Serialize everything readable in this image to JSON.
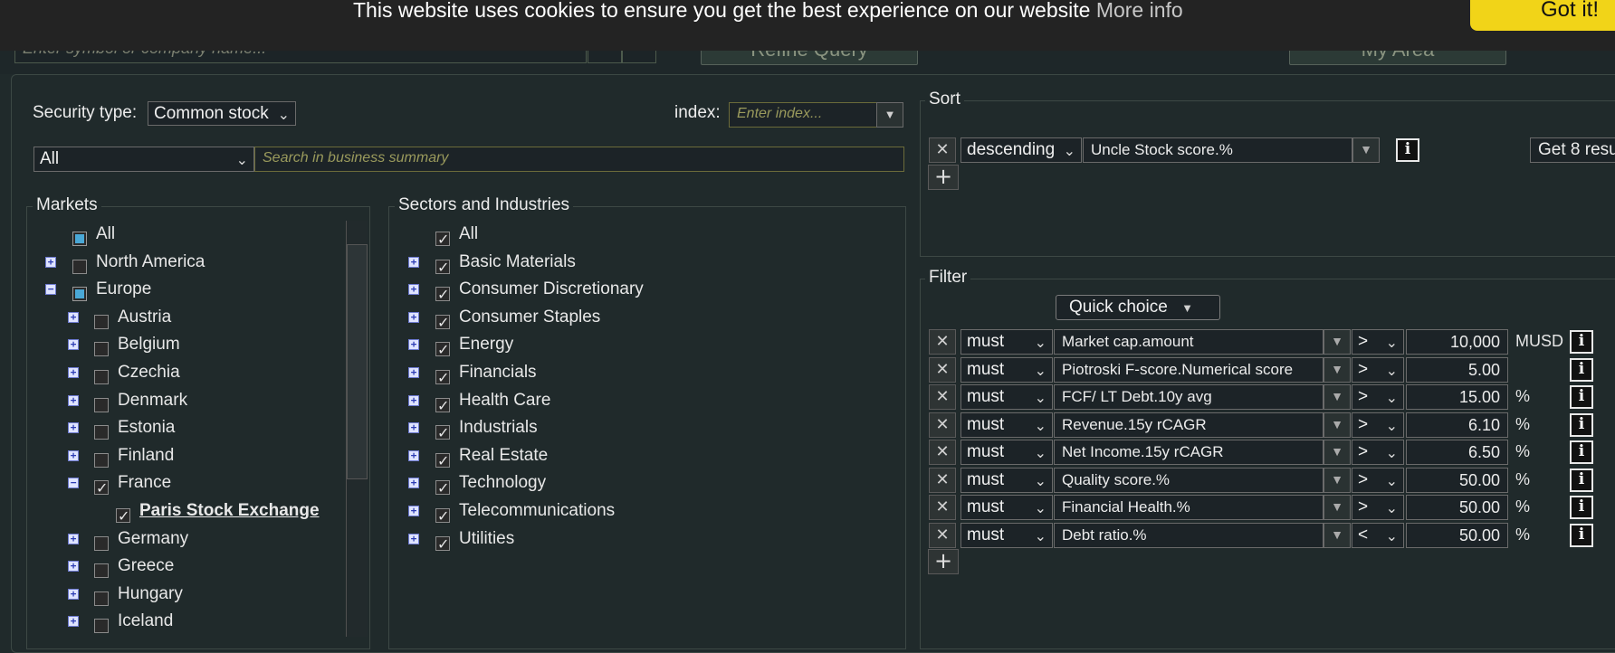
{
  "top": {
    "search_placeholder": "Enter symbol or company name...",
    "refine_label": "Refine Query",
    "myarea_label": "My Area"
  },
  "cookie": {
    "message": "This website uses cookies to ensure you get the best experience on our website",
    "more_info": "More info",
    "got_it": "Got it!"
  },
  "security": {
    "label": "Security type:",
    "value": "Common stock",
    "index_label": "index:",
    "index_placeholder": "Enter index...",
    "scope_value": "All",
    "business_placeholder": "Search in business summary"
  },
  "markets": {
    "title": "Markets",
    "items": [
      {
        "label": "All",
        "state": "partial",
        "expander": "",
        "level": 0
      },
      {
        "label": "North America",
        "state": "unchecked",
        "expander": "+",
        "level": 0
      },
      {
        "label": "Europe",
        "state": "partial",
        "expander": "−",
        "level": 0
      },
      {
        "label": "Austria",
        "state": "unchecked",
        "expander": "+",
        "level": 1
      },
      {
        "label": "Belgium",
        "state": "unchecked",
        "expander": "+",
        "level": 1
      },
      {
        "label": "Czechia",
        "state": "unchecked",
        "expander": "+",
        "level": 1
      },
      {
        "label": "Denmark",
        "state": "unchecked",
        "expander": "+",
        "level": 1
      },
      {
        "label": "Estonia",
        "state": "unchecked",
        "expander": "+",
        "level": 1
      },
      {
        "label": "Finland",
        "state": "unchecked",
        "expander": "+",
        "level": 1
      },
      {
        "label": "France",
        "state": "checked",
        "expander": "−",
        "level": 1
      },
      {
        "label": "Paris Stock Exchange",
        "state": "checked",
        "expander": "",
        "level": 2
      },
      {
        "label": "Germany",
        "state": "unchecked",
        "expander": "+",
        "level": 1
      },
      {
        "label": "Greece",
        "state": "unchecked",
        "expander": "+",
        "level": 1
      },
      {
        "label": "Hungary",
        "state": "unchecked",
        "expander": "+",
        "level": 1
      },
      {
        "label": "Iceland",
        "state": "unchecked",
        "expander": "+",
        "level": 1
      }
    ]
  },
  "sectors": {
    "title": "Sectors and Industries",
    "items": [
      {
        "label": "All",
        "expander": ""
      },
      {
        "label": "Basic Materials",
        "expander": "+"
      },
      {
        "label": "Consumer Discretionary",
        "expander": "+"
      },
      {
        "label": "Consumer Staples",
        "expander": "+"
      },
      {
        "label": "Energy",
        "expander": "+"
      },
      {
        "label": "Financials",
        "expander": "+"
      },
      {
        "label": "Health Care",
        "expander": "+"
      },
      {
        "label": "Industrials",
        "expander": "+"
      },
      {
        "label": "Real Estate",
        "expander": "+"
      },
      {
        "label": "Technology",
        "expander": "+"
      },
      {
        "label": "Telecommunications",
        "expander": "+"
      },
      {
        "label": "Utilities",
        "expander": "+"
      }
    ]
  },
  "sort": {
    "title": "Sort",
    "order": "descending",
    "field": "Uncle Stock score.%",
    "results_button": "Get 8 resu"
  },
  "filter": {
    "title": "Filter",
    "quick_choice": "Quick choice",
    "rows": [
      {
        "mode": "must",
        "field": "Market cap.amount",
        "op": ">",
        "value": "10,000",
        "unit": "MUSD"
      },
      {
        "mode": "must",
        "field": "Piotroski F-score.Numerical score",
        "op": ">",
        "value": "5.00",
        "unit": ""
      },
      {
        "mode": "must",
        "field": "FCF/ LT Debt.10y avg",
        "op": ">",
        "value": "15.00",
        "unit": "%"
      },
      {
        "mode": "must",
        "field": "Revenue.15y rCAGR",
        "op": ">",
        "value": "6.10",
        "unit": "%"
      },
      {
        "mode": "must",
        "field": "Net Income.15y rCAGR",
        "op": ">",
        "value": "6.50",
        "unit": "%"
      },
      {
        "mode": "must",
        "field": "Quality score.%",
        "op": ">",
        "value": "50.00",
        "unit": "%"
      },
      {
        "mode": "must",
        "field": "Financial Health.%",
        "op": ">",
        "value": "50.00",
        "unit": "%"
      },
      {
        "mode": "must",
        "field": "Debt ratio.%",
        "op": "<",
        "value": "50.00",
        "unit": "%"
      }
    ]
  }
}
